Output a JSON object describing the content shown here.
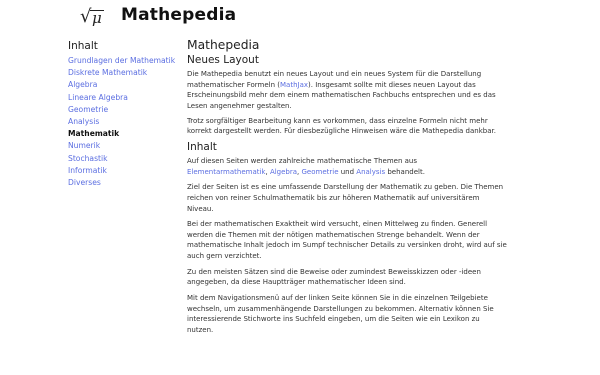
{
  "header": {
    "logo_icon": "sqrt-mu-icon",
    "logo_radical": "√",
    "logo_symbol": "μ",
    "title": "Mathepedia"
  },
  "sidebar": {
    "title": "Inhalt",
    "items": [
      {
        "label": "Grundlagen der Mathematik",
        "active": false
      },
      {
        "label": "Diskrete Mathematik",
        "active": false
      },
      {
        "label": "Algebra",
        "active": false
      },
      {
        "label": "Lineare Algebra",
        "active": false
      },
      {
        "label": "Geometrie",
        "active": false
      },
      {
        "label": "Analysis",
        "active": false
      },
      {
        "label": "Mathematik",
        "active": true
      },
      {
        "label": "Numerik",
        "active": false
      },
      {
        "label": "Stochastik",
        "active": false
      },
      {
        "label": "Informatik",
        "active": false
      },
      {
        "label": "Diverses",
        "active": false
      }
    ]
  },
  "main": {
    "title": "Mathepedia",
    "subtitle": "Neues Layout",
    "p1_a": "Die Mathepedia benutzt ein neues Layout und ein neues System für die Darstellung mathematischer Formeln (",
    "p1_link": "MathJax",
    "p1_b": "). Insgesamt sollte mit dieses neuen Layout das Erscheinungsbild mehr dem einem mathematischen Fachbuchs entsprechen und es das Lesen angenehmer gestalten.",
    "p2": "Trotz sorgfältiger Bearbeitung kann es vorkommen, dass einzelne Formeln nicht mehr korrekt dargestellt werden. Für diesbezügliche Hinweisen wäre die Mathepedia dankbar.",
    "section_title": "Inhalt",
    "p3_a": "Auf diesen Seiten werden zahlreiche mathematische Themen aus",
    "p3_link1": "Elementarmathematik",
    "p3_sep1": ", ",
    "p3_link2": "Algebra",
    "p3_sep2": ", ",
    "p3_link3": "Geometrie",
    "p3_and": " und ",
    "p3_link4": "Analysis",
    "p3_b": " behandelt.",
    "p4": "Ziel der Seiten ist es eine umfassende Darstellung der Mathematik zu geben. Die Themen reichen von reiner Schulmathematik bis zur höheren Mathematik auf universitärem Niveau.",
    "p5": "Bei der mathematischen Exaktheit wird versucht, einen Mittelweg zu finden. Generell werden die Themen mit der nötigen mathematischen Strenge behandelt. Wenn der mathematische Inhalt jedoch im Sumpf technischer Details zu versinken droht, wird auf sie auch gern verzichtet.",
    "p6": "Zu den meisten Sätzen sind die Beweise oder zumindest Beweisskizzen oder -ideen angegeben, da diese Hauptträger mathematischer Ideen sind.",
    "p7": "Mit dem Navigationsmenü auf der linken Seite können Sie in die einzelnen Teilgebiete wechseln, um zusammenhängende Darstellungen zu bekommen. Alternativ können Sie interessierende Stichworte ins Suchfeld eingeben, um die Seiten wie ein Lexikon zu nutzen."
  },
  "colors": {
    "link": "#5b6ee1",
    "text": "#333333",
    "background": "#ffffff"
  }
}
